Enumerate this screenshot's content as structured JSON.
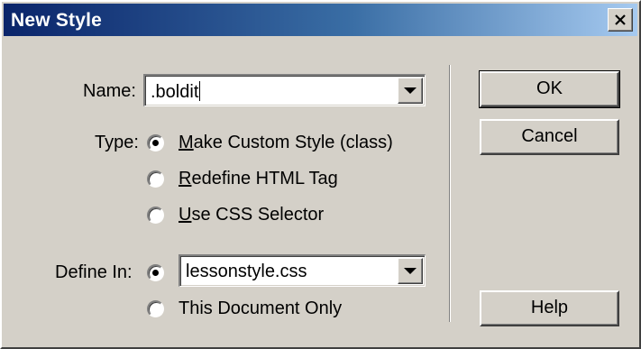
{
  "window": {
    "title": "New Style"
  },
  "name_field": {
    "label": "Name:",
    "value": ".boldit"
  },
  "type": {
    "label": "Type:",
    "options": [
      {
        "label_first": "M",
        "label_rest": "ake Custom Style (class)",
        "selected": true
      },
      {
        "label_first": "R",
        "label_rest": "edefine HTML Tag",
        "selected": false
      },
      {
        "label_first": "U",
        "label_rest": "se CSS Selector",
        "selected": false
      }
    ]
  },
  "define_in": {
    "label": "Define In:",
    "file_value": "lessonstyle.css",
    "file_selected": true,
    "alt_option": "This Document Only",
    "alt_selected": false
  },
  "buttons": {
    "ok": "OK",
    "cancel": "Cancel",
    "help": "Help"
  },
  "icons": {
    "close": "close-icon",
    "dropdown": "chevron-down-icon"
  }
}
